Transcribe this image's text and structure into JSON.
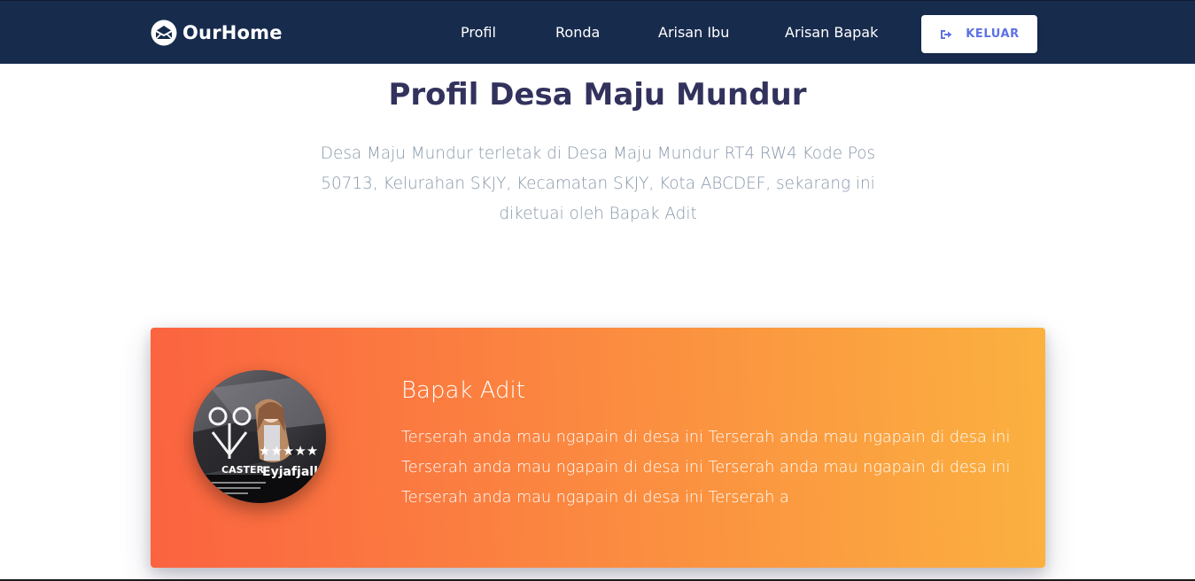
{
  "navbar": {
    "brand": "OurHome",
    "links": [
      "Profil",
      "Ronda",
      "Arisan Ibu",
      "Arisan Bapak"
    ],
    "logout_label": "KELUAR",
    "background": "#172b4d"
  },
  "main": {
    "title": "Profil Desa Maju Mundur",
    "description": "Desa Maju Mundur terletak di Desa Maju Mundur RT4 RW4 Kode Pos 50713, Kelurahan SKJY, Kecamatan SKJY, Kota ABCDEF, sekarang ini diketuai oleh Bapak Adit"
  },
  "leader_card": {
    "name": "Bapak Adit",
    "text": "Terserah anda mau ngapain di desa ini Terserah anda mau ngapain di desa ini Terserah anda mau ngapain di desa ini Terserah anda mau ngapain di desa ini Terserah anda mau ngapain di desa ini Terserah a",
    "avatar_caption": "Eyjafjalla",
    "avatar_tag": "CASTER",
    "gradient_from": "#fb6340",
    "gradient_to": "#fbb140"
  },
  "colors": {
    "accent": "#5e72e4",
    "title": "#32325d",
    "muted": "#8898aa"
  }
}
